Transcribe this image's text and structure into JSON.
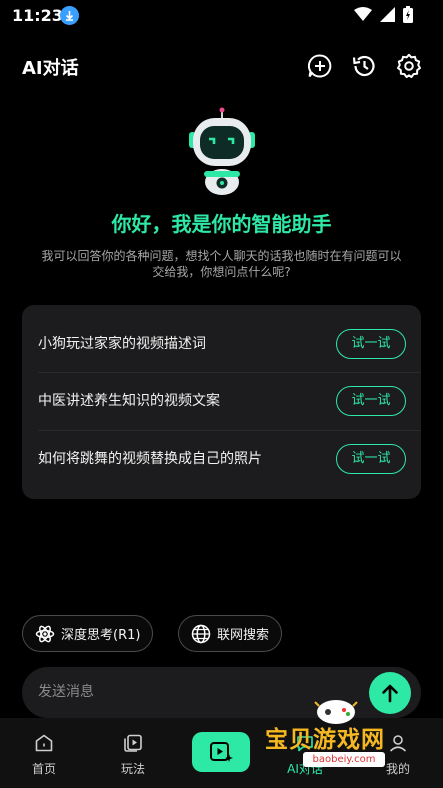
{
  "status": {
    "time": "11:23"
  },
  "header": {
    "title": "AI对话"
  },
  "hero": {
    "greeting": "你好，我是你的智能助手",
    "intro": "我可以回答你的各种问题，想找个人聊天的话我也随时在有问题可以交给我，你想问点什么呢?"
  },
  "suggestions": [
    {
      "text": "小狗玩过家家的视频描述词",
      "action": "试一试"
    },
    {
      "text": "中医讲述养生知识的视频文案",
      "action": "试一试"
    },
    {
      "text": "如何将跳舞的视频替换成自己的照片",
      "action": "试一试"
    }
  ],
  "chips": {
    "deep_think": "深度思考(R1)",
    "web_search": "联网搜索"
  },
  "input": {
    "placeholder": "发送消息"
  },
  "nav": {
    "home": "首页",
    "play": "玩法",
    "chat": "AI对话",
    "mine": "我的"
  },
  "watermark": {
    "brand": "宝贝游戏网",
    "url": "baobeiy.com"
  },
  "colors": {
    "accent": "#2ee8a6",
    "card": "#1c1c1e",
    "background": "#000000"
  }
}
